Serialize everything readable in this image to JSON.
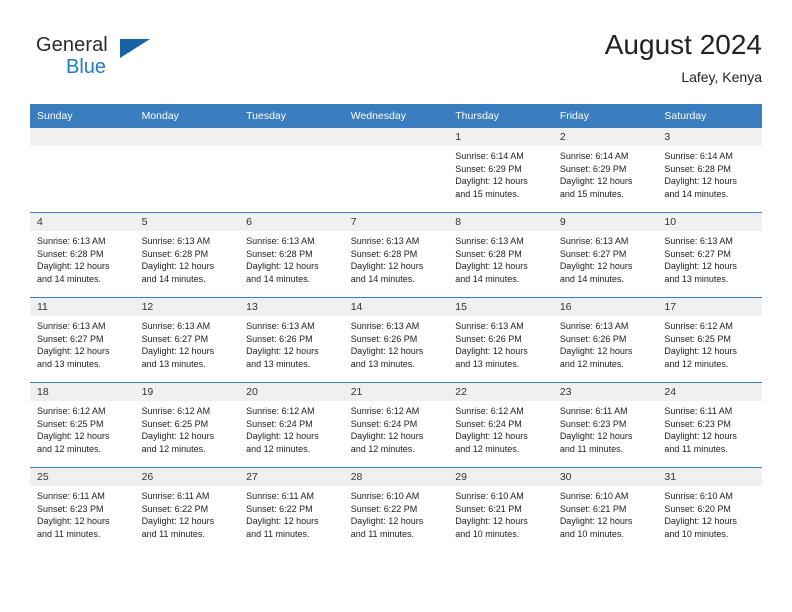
{
  "brand": {
    "word_one": "General",
    "word_two": "Blue",
    "logo_icon": "triangle-logo-icon"
  },
  "header": {
    "title": "August 2024",
    "subtitle": "Lafey, Kenya"
  },
  "colors": {
    "header_blue": "#3a7ebf",
    "brand_blue": "#1f7bc1",
    "logo_blue": "#1763a8",
    "cell_head_gray": "#f0f0f0"
  },
  "weekdays": [
    "Sunday",
    "Monday",
    "Tuesday",
    "Wednesday",
    "Thursday",
    "Friday",
    "Saturday"
  ],
  "weeks": [
    [
      {
        "day": "",
        "sunrise": "",
        "sunset": "",
        "daylight_1": "",
        "daylight_2": ""
      },
      {
        "day": "",
        "sunrise": "",
        "sunset": "",
        "daylight_1": "",
        "daylight_2": ""
      },
      {
        "day": "",
        "sunrise": "",
        "sunset": "",
        "daylight_1": "",
        "daylight_2": ""
      },
      {
        "day": "",
        "sunrise": "",
        "sunset": "",
        "daylight_1": "",
        "daylight_2": ""
      },
      {
        "day": "1",
        "sunrise": "Sunrise: 6:14 AM",
        "sunset": "Sunset: 6:29 PM",
        "daylight_1": "Daylight: 12 hours",
        "daylight_2": "and 15 minutes."
      },
      {
        "day": "2",
        "sunrise": "Sunrise: 6:14 AM",
        "sunset": "Sunset: 6:29 PM",
        "daylight_1": "Daylight: 12 hours",
        "daylight_2": "and 15 minutes."
      },
      {
        "day": "3",
        "sunrise": "Sunrise: 6:14 AM",
        "sunset": "Sunset: 6:28 PM",
        "daylight_1": "Daylight: 12 hours",
        "daylight_2": "and 14 minutes."
      }
    ],
    [
      {
        "day": "4",
        "sunrise": "Sunrise: 6:13 AM",
        "sunset": "Sunset: 6:28 PM",
        "daylight_1": "Daylight: 12 hours",
        "daylight_2": "and 14 minutes."
      },
      {
        "day": "5",
        "sunrise": "Sunrise: 6:13 AM",
        "sunset": "Sunset: 6:28 PM",
        "daylight_1": "Daylight: 12 hours",
        "daylight_2": "and 14 minutes."
      },
      {
        "day": "6",
        "sunrise": "Sunrise: 6:13 AM",
        "sunset": "Sunset: 6:28 PM",
        "daylight_1": "Daylight: 12 hours",
        "daylight_2": "and 14 minutes."
      },
      {
        "day": "7",
        "sunrise": "Sunrise: 6:13 AM",
        "sunset": "Sunset: 6:28 PM",
        "daylight_1": "Daylight: 12 hours",
        "daylight_2": "and 14 minutes."
      },
      {
        "day": "8",
        "sunrise": "Sunrise: 6:13 AM",
        "sunset": "Sunset: 6:28 PM",
        "daylight_1": "Daylight: 12 hours",
        "daylight_2": "and 14 minutes."
      },
      {
        "day": "9",
        "sunrise": "Sunrise: 6:13 AM",
        "sunset": "Sunset: 6:27 PM",
        "daylight_1": "Daylight: 12 hours",
        "daylight_2": "and 14 minutes."
      },
      {
        "day": "10",
        "sunrise": "Sunrise: 6:13 AM",
        "sunset": "Sunset: 6:27 PM",
        "daylight_1": "Daylight: 12 hours",
        "daylight_2": "and 13 minutes."
      }
    ],
    [
      {
        "day": "11",
        "sunrise": "Sunrise: 6:13 AM",
        "sunset": "Sunset: 6:27 PM",
        "daylight_1": "Daylight: 12 hours",
        "daylight_2": "and 13 minutes."
      },
      {
        "day": "12",
        "sunrise": "Sunrise: 6:13 AM",
        "sunset": "Sunset: 6:27 PM",
        "daylight_1": "Daylight: 12 hours",
        "daylight_2": "and 13 minutes."
      },
      {
        "day": "13",
        "sunrise": "Sunrise: 6:13 AM",
        "sunset": "Sunset: 6:26 PM",
        "daylight_1": "Daylight: 12 hours",
        "daylight_2": "and 13 minutes."
      },
      {
        "day": "14",
        "sunrise": "Sunrise: 6:13 AM",
        "sunset": "Sunset: 6:26 PM",
        "daylight_1": "Daylight: 12 hours",
        "daylight_2": "and 13 minutes."
      },
      {
        "day": "15",
        "sunrise": "Sunrise: 6:13 AM",
        "sunset": "Sunset: 6:26 PM",
        "daylight_1": "Daylight: 12 hours",
        "daylight_2": "and 13 minutes."
      },
      {
        "day": "16",
        "sunrise": "Sunrise: 6:13 AM",
        "sunset": "Sunset: 6:26 PM",
        "daylight_1": "Daylight: 12 hours",
        "daylight_2": "and 12 minutes."
      },
      {
        "day": "17",
        "sunrise": "Sunrise: 6:12 AM",
        "sunset": "Sunset: 6:25 PM",
        "daylight_1": "Daylight: 12 hours",
        "daylight_2": "and 12 minutes."
      }
    ],
    [
      {
        "day": "18",
        "sunrise": "Sunrise: 6:12 AM",
        "sunset": "Sunset: 6:25 PM",
        "daylight_1": "Daylight: 12 hours",
        "daylight_2": "and 12 minutes."
      },
      {
        "day": "19",
        "sunrise": "Sunrise: 6:12 AM",
        "sunset": "Sunset: 6:25 PM",
        "daylight_1": "Daylight: 12 hours",
        "daylight_2": "and 12 minutes."
      },
      {
        "day": "20",
        "sunrise": "Sunrise: 6:12 AM",
        "sunset": "Sunset: 6:24 PM",
        "daylight_1": "Daylight: 12 hours",
        "daylight_2": "and 12 minutes."
      },
      {
        "day": "21",
        "sunrise": "Sunrise: 6:12 AM",
        "sunset": "Sunset: 6:24 PM",
        "daylight_1": "Daylight: 12 hours",
        "daylight_2": "and 12 minutes."
      },
      {
        "day": "22",
        "sunrise": "Sunrise: 6:12 AM",
        "sunset": "Sunset: 6:24 PM",
        "daylight_1": "Daylight: 12 hours",
        "daylight_2": "and 12 minutes."
      },
      {
        "day": "23",
        "sunrise": "Sunrise: 6:11 AM",
        "sunset": "Sunset: 6:23 PM",
        "daylight_1": "Daylight: 12 hours",
        "daylight_2": "and 11 minutes."
      },
      {
        "day": "24",
        "sunrise": "Sunrise: 6:11 AM",
        "sunset": "Sunset: 6:23 PM",
        "daylight_1": "Daylight: 12 hours",
        "daylight_2": "and 11 minutes."
      }
    ],
    [
      {
        "day": "25",
        "sunrise": "Sunrise: 6:11 AM",
        "sunset": "Sunset: 6:23 PM",
        "daylight_1": "Daylight: 12 hours",
        "daylight_2": "and 11 minutes."
      },
      {
        "day": "26",
        "sunrise": "Sunrise: 6:11 AM",
        "sunset": "Sunset: 6:22 PM",
        "daylight_1": "Daylight: 12 hours",
        "daylight_2": "and 11 minutes."
      },
      {
        "day": "27",
        "sunrise": "Sunrise: 6:11 AM",
        "sunset": "Sunset: 6:22 PM",
        "daylight_1": "Daylight: 12 hours",
        "daylight_2": "and 11 minutes."
      },
      {
        "day": "28",
        "sunrise": "Sunrise: 6:10 AM",
        "sunset": "Sunset: 6:22 PM",
        "daylight_1": "Daylight: 12 hours",
        "daylight_2": "and 11 minutes."
      },
      {
        "day": "29",
        "sunrise": "Sunrise: 6:10 AM",
        "sunset": "Sunset: 6:21 PM",
        "daylight_1": "Daylight: 12 hours",
        "daylight_2": "and 10 minutes."
      },
      {
        "day": "30",
        "sunrise": "Sunrise: 6:10 AM",
        "sunset": "Sunset: 6:21 PM",
        "daylight_1": "Daylight: 12 hours",
        "daylight_2": "and 10 minutes."
      },
      {
        "day": "31",
        "sunrise": "Sunrise: 6:10 AM",
        "sunset": "Sunset: 6:20 PM",
        "daylight_1": "Daylight: 12 hours",
        "daylight_2": "and 10 minutes."
      }
    ]
  ]
}
